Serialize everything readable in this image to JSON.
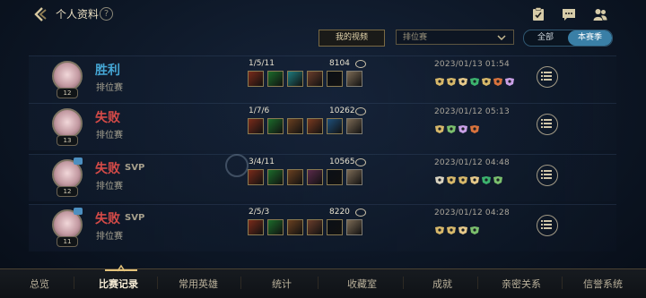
{
  "header": {
    "title": "个人资料",
    "help_label": "?"
  },
  "filters": {
    "video_button": "我的视频",
    "mode_select": "排位赛",
    "segment": [
      "全部",
      "本赛季"
    ],
    "active_segment": "本赛季"
  },
  "matches": [
    {
      "result": "胜利",
      "mvp": "",
      "mode": "排位赛",
      "level": "12",
      "kda": "1/5/11",
      "score": "8104",
      "date": "2023/01/13 01:54",
      "item_colors": [
        "#7a2b1a",
        "#1c6b2a",
        "#1e7a7c",
        "#6a3d2b",
        "#0b1016",
        "#7b6a55"
      ],
      "badge_colors": [
        "#d7b86a",
        "#d7b86a",
        "#e6c98a",
        "#3cb36e",
        "#d7b86a",
        "#d9733d",
        "#c9a0e6"
      ]
    },
    {
      "result": "失败",
      "mvp": "",
      "mode": "排位赛",
      "level": "13",
      "kda": "1/7/6",
      "score": "10262",
      "date": "2023/01/12 05:13",
      "item_colors": [
        "#7a2b1a",
        "#1c6b2a",
        "#6a4020",
        "#7a3a20",
        "#1e4f7a",
        "#7b6a55"
      ],
      "badge_colors": [
        "#d7b86a",
        "#7bbf6d",
        "#c9a0e6",
        "#d9733d"
      ]
    },
    {
      "result": "失败",
      "mvp": "SVP",
      "mode": "排位赛",
      "level": "12",
      "kda": "3/4/11",
      "score": "10565",
      "date": "2023/01/12 04:48",
      "item_colors": [
        "#7a2b1a",
        "#1c6b2a",
        "#6a4020",
        "#5a2a4a",
        "#0b1016",
        "#7b6a55"
      ],
      "badge_colors": [
        "#d8d2c0",
        "#d7b86a",
        "#d7b86a",
        "#e6c98a",
        "#3cb36e",
        "#7bbf6d"
      ]
    },
    {
      "result": "失败",
      "mvp": "SVP",
      "mode": "排位赛",
      "level": "11",
      "kda": "2/5/3",
      "score": "8220",
      "date": "2023/01/12 04:28",
      "item_colors": [
        "#7a2b1a",
        "#1c6b2a",
        "#6a4020",
        "#6a3d2b",
        "#0b1016",
        "#7b6a55"
      ],
      "badge_colors": [
        "#d7b86a",
        "#d7b86a",
        "#e6c98a",
        "#7bbf6d"
      ]
    }
  ],
  "nav": [
    "总览",
    "比赛记录",
    "常用英雄",
    "统计",
    "收藏室",
    "成就",
    "亲密关系",
    "信誉系统"
  ],
  "active_nav": "比赛记录",
  "colors": {
    "win": "#45a6d4",
    "loss": "#d64b48",
    "accent_gold": "#cdbe91",
    "active_tab_blue": "#3a7fa6"
  },
  "icons": {
    "back": "chevron-left-icon",
    "help": "help-circle-icon",
    "checklist": "clipboard-check-icon",
    "chat": "chat-bubble-icon",
    "friends": "friends-icon",
    "menu": "list-menu-icon",
    "dropdown": "chevron-down-icon"
  }
}
